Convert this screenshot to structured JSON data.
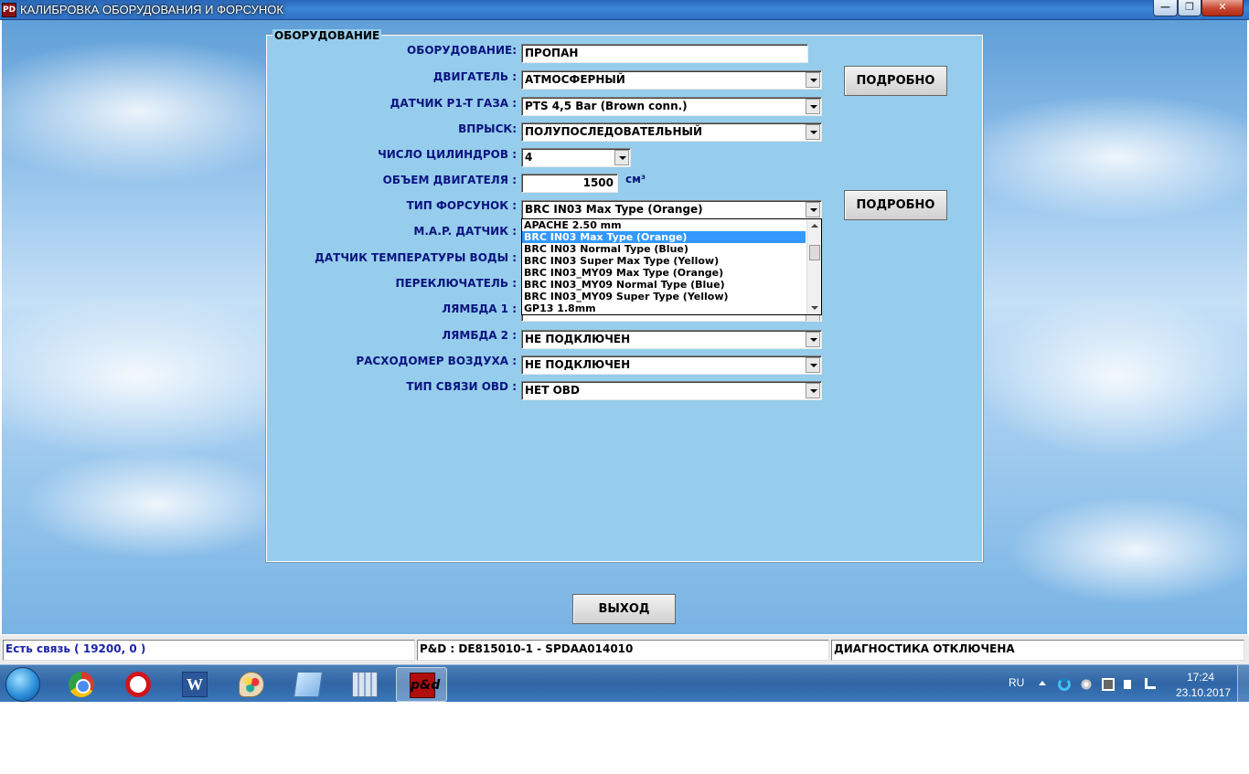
{
  "window": {
    "title": "КАЛИБРОВКА ОБОРУДОВАНИЯ И ФОРСУНОК",
    "app_icon_text": "PD",
    "min_glyph": "—",
    "max_glyph": "❐",
    "close_glyph": "✕"
  },
  "group": {
    "title": "ОБОРУДОВАНИЕ"
  },
  "form": {
    "equipment_label": "ОБОРУДОВАНИЕ:",
    "equipment_value": "ПРОПАН",
    "engine_label": "ДВИГАТЕЛЬ :",
    "engine_value": "АТМОСФЕРНЫЙ",
    "sensor_label": "ДАТЧИК P1-T ГАЗА :",
    "sensor_value": "PTS 4,5 Bar (Brown conn.)",
    "injection_label": "ВПРЫСК:",
    "injection_value": "ПОЛУПОСЛЕДОВАТЕЛЬНЫЙ",
    "cylinders_label": "ЧИСЛО ЦИЛИНДРОВ :",
    "cylinders_value": "4",
    "volume_label": "ОБЪЕМ ДВИГАТЕЛЯ :",
    "volume_value": "1500",
    "volume_unit": "см³",
    "injector_label": "ТИП ФОРСУНОК :",
    "injector_value": "BRC IN03 Max Type (Orange)",
    "map_label": "M.A.P. ДАТЧИК :",
    "water_temp_label": "ДАТЧИК ТЕМПЕРАТУРЫ ВОДЫ :",
    "switch_label": "ПЕРЕКЛЮЧАТЕЛЬ :",
    "lambda1_label": "ЛЯМБДА 1 :",
    "lambda2_label": "ЛЯМБДА 2 :",
    "lambda2_value": "НЕ ПОДКЛЮЧЕН",
    "airflow_label": "РАСХОДОМЕР ВОЗДУХА :",
    "airflow_value": "НЕ ПОДКЛЮЧЕН",
    "obd_label": "ТИП СВЯЗИ OBD :",
    "obd_value": "НЕТ OBD",
    "details_label": "ПОДРОБНО",
    "exit_label": "ВЫХОД"
  },
  "injector_options": [
    {
      "label": "APACHE 2.50 mm",
      "selected": false
    },
    {
      "label": "BRC IN03 Max Type (Orange)",
      "selected": true
    },
    {
      "label": "BRC IN03 Normal Type (Blue)",
      "selected": false
    },
    {
      "label": "BRC IN03 Super Max Type (Yellow)",
      "selected": false
    },
    {
      "label": "BRC IN03_MY09 Max Type (Orange)",
      "selected": false
    },
    {
      "label": "BRC IN03_MY09 Normal Type (Blue)",
      "selected": false
    },
    {
      "label": "BRC IN03_MY09 Super Type (Yellow)",
      "selected": false
    },
    {
      "label": "GP13 1.8mm",
      "selected": false
    }
  ],
  "status": {
    "connection": "Есть связь ( 19200,  0 )",
    "device": "P&D : DE815010-1 - SPDAA014010",
    "diagnostics": "ДИАГНОСТИКА ОТКЛЮЧЕНА",
    "connection_color": "#1a24a8"
  },
  "taskbar": {
    "apps": [
      {
        "name": "taskbar-chrome",
        "icon": "chrome-icon",
        "glyph": ""
      },
      {
        "name": "taskbar-opera",
        "icon": "opera-icon",
        "glyph": ""
      },
      {
        "name": "taskbar-word",
        "icon": "word-icon",
        "glyph": "W"
      },
      {
        "name": "taskbar-paint",
        "icon": "paint-icon",
        "glyph": ""
      },
      {
        "name": "taskbar-notes",
        "icon": "notes-icon",
        "glyph": ""
      },
      {
        "name": "taskbar-calculator",
        "icon": "calculator-icon",
        "glyph": ""
      },
      {
        "name": "taskbar-pd-app",
        "icon": "pd-app-icon",
        "glyph": "p&d"
      }
    ],
    "lang": "RU",
    "time": "17:24",
    "date": "23.10.2017"
  }
}
